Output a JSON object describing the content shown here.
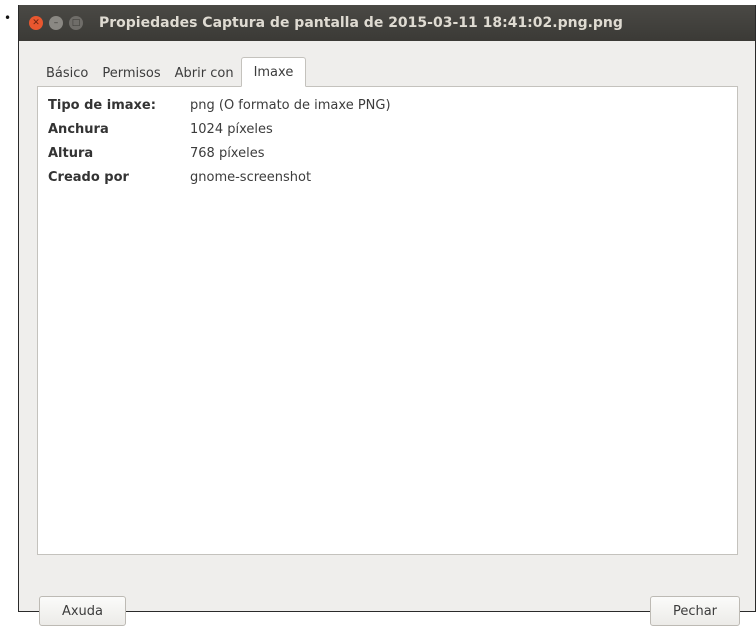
{
  "bullet": "•",
  "window": {
    "title": "Propiedades Captura de pantalla de 2015-03-11 18:41:02.png.png",
    "buttons": {
      "close": "✕",
      "minimize": "–",
      "maximize": "□"
    }
  },
  "tabs": [
    {
      "label": "Básico"
    },
    {
      "label": "Permisos"
    },
    {
      "label": "Abrir con"
    },
    {
      "label": "Imaxe"
    }
  ],
  "active_tab": "Imaxe",
  "properties": [
    {
      "key": "Tipo de imaxe:",
      "value": "png (O formato de imaxe PNG)"
    },
    {
      "key": "Anchura",
      "value": "1024 píxeles"
    },
    {
      "key": "Altura",
      "value": "768 píxeles"
    },
    {
      "key": "Creado por",
      "value": "gnome-screenshot"
    }
  ],
  "footer": {
    "help_label": "Axuda",
    "close_label": "Pechar"
  }
}
